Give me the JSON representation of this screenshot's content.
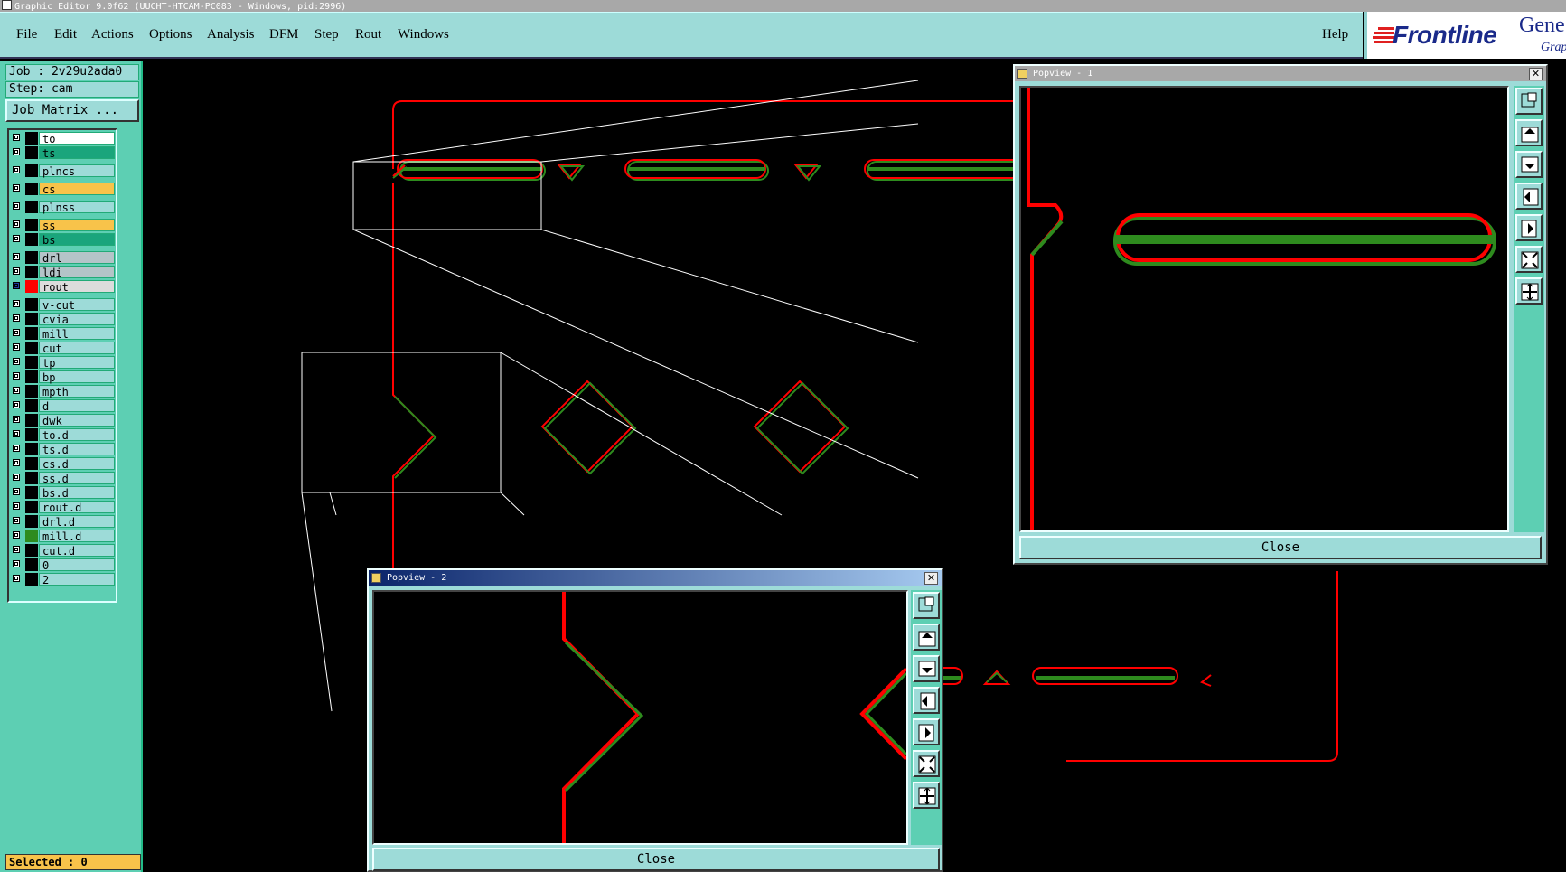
{
  "window": {
    "title": "Graphic Editor 9.0f62  (UUCHT-HTCAM-PC083 - Windows, pid:2996)"
  },
  "menu": {
    "items": [
      {
        "label": "File"
      },
      {
        "label": "Edit"
      },
      {
        "label": "Actions"
      },
      {
        "label": "Options"
      },
      {
        "label": "Analysis"
      },
      {
        "label": "DFM"
      },
      {
        "label": "Step"
      },
      {
        "label": "Rout"
      },
      {
        "label": "Windows"
      }
    ],
    "help": "Help"
  },
  "logo": {
    "brand": "Frontline",
    "product": "Gene",
    "sub": "Grap"
  },
  "sidebar": {
    "job": "Job : 2v29u2ada0",
    "step": "Step: cam",
    "job_matrix": "Job Matrix ...",
    "selected": "Selected : 0",
    "layers": [
      {
        "name": "to",
        "bg": "#ffffff",
        "swatch": "#000000"
      },
      {
        "name": "ts",
        "bg": "#1aa57c",
        "swatch": "#000000"
      },
      {
        "name": "plncs",
        "bg": "#9ddbd8",
        "swatch": "#000000"
      },
      {
        "name": "cs",
        "bg": "#f8c34a",
        "swatch": "#000000"
      },
      {
        "name": "plnss",
        "bg": "#9ddbd8",
        "swatch": "#000000"
      },
      {
        "name": "ss",
        "bg": "#f8c34a",
        "swatch": "#000000"
      },
      {
        "name": "bs",
        "bg": "#1aa57c",
        "swatch": "#000000"
      },
      {
        "name": "drl",
        "bg": "#b4c4c8",
        "swatch": "#000000"
      },
      {
        "name": "ldi",
        "bg": "#b4c4c8",
        "swatch": "#000000"
      },
      {
        "name": "rout",
        "bg": "#dcdcdc",
        "swatch": "#ff0000",
        "active": true
      },
      {
        "name": "v-cut",
        "bg": "#9ddbd8",
        "swatch": "#000000"
      },
      {
        "name": "cvia",
        "bg": "#9ddbd8",
        "swatch": "#000000"
      },
      {
        "name": "mill",
        "bg": "#9ddbd8",
        "swatch": "#000000"
      },
      {
        "name": "cut",
        "bg": "#9ddbd8",
        "swatch": "#000000"
      },
      {
        "name": "tp",
        "bg": "#9ddbd8",
        "swatch": "#000000"
      },
      {
        "name": "bp",
        "bg": "#9ddbd8",
        "swatch": "#000000"
      },
      {
        "name": "mpth",
        "bg": "#9ddbd8",
        "swatch": "#000000"
      },
      {
        "name": "d",
        "bg": "#9ddbd8",
        "swatch": "#000000"
      },
      {
        "name": "dwk",
        "bg": "#9ddbd8",
        "swatch": "#000000"
      },
      {
        "name": "to.d",
        "bg": "#9ddbd8",
        "swatch": "#000000"
      },
      {
        "name": "ts.d",
        "bg": "#9ddbd8",
        "swatch": "#000000"
      },
      {
        "name": "cs.d",
        "bg": "#9ddbd8",
        "swatch": "#000000"
      },
      {
        "name": "ss.d",
        "bg": "#9ddbd8",
        "swatch": "#000000"
      },
      {
        "name": "bs.d",
        "bg": "#9ddbd8",
        "swatch": "#000000"
      },
      {
        "name": "rout.d",
        "bg": "#9ddbd8",
        "swatch": "#000000"
      },
      {
        "name": "drl.d",
        "bg": "#9ddbd8",
        "swatch": "#000000"
      },
      {
        "name": "mill.d",
        "bg": "#9ddbd8",
        "swatch": "#2e8b1e"
      },
      {
        "name": "cut.d",
        "bg": "#9ddbd8",
        "swatch": "#000000"
      },
      {
        "name": "0",
        "bg": "#9ddbd8",
        "swatch": "#000000"
      },
      {
        "name": "2",
        "bg": "#9ddbd8",
        "swatch": "#000000"
      }
    ]
  },
  "popview1": {
    "title": "Popview - 1",
    "close_label": "Close",
    "close_x": "✕"
  },
  "popview2": {
    "title": "Popview - 2",
    "close_label": "Close",
    "close_x": "✕"
  },
  "colors": {
    "rout": "#ff0000",
    "mill": "#2e8b1e",
    "panel": "#9ddbd8",
    "sidebar": "#5dcfb3",
    "popup2_title": "#0a246a"
  }
}
